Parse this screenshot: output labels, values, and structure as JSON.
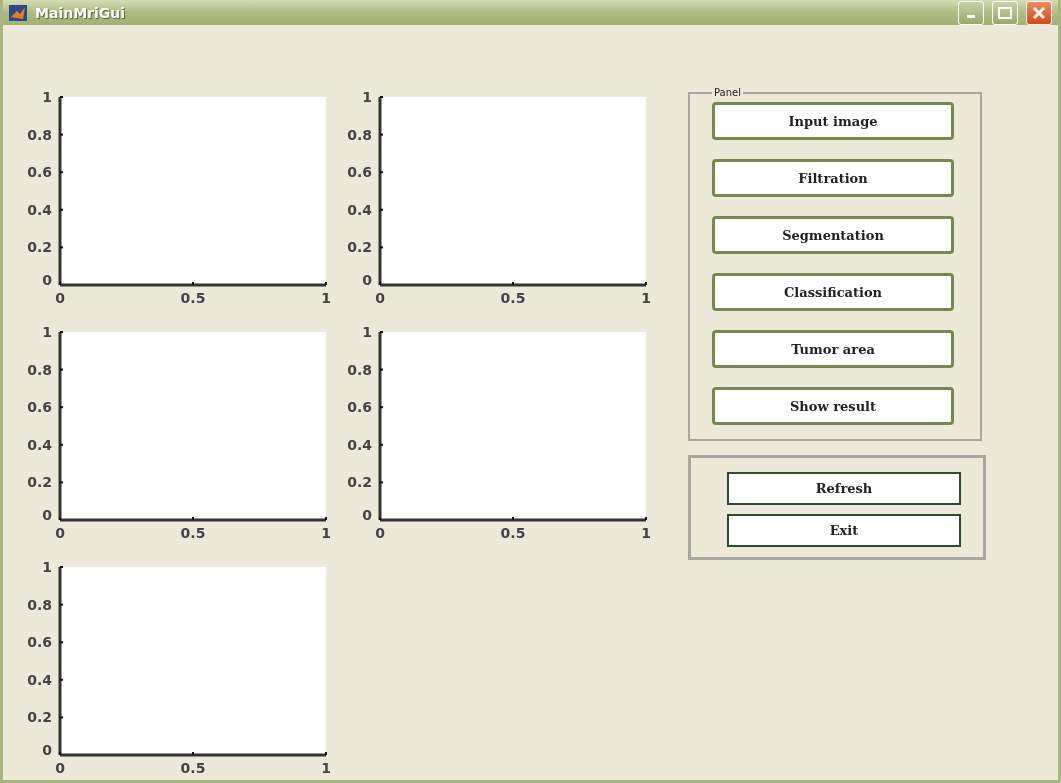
{
  "window": {
    "title": "MainMriGui"
  },
  "axes": [
    {
      "chart_data": {
        "type": "line",
        "xlim": [
          0,
          1
        ],
        "ylim": [
          0,
          1
        ],
        "xticks": [
          0,
          0.5,
          1
        ],
        "yticks": [
          0,
          0.2,
          0.4,
          0.6,
          0.8,
          1
        ]
      }
    },
    {
      "chart_data": {
        "type": "line",
        "xlim": [
          0,
          1
        ],
        "ylim": [
          0,
          1
        ],
        "xticks": [
          0,
          0.5,
          1
        ],
        "yticks": [
          0,
          0.2,
          0.4,
          0.6,
          0.8,
          1
        ]
      }
    },
    {
      "chart_data": {
        "type": "line",
        "xlim": [
          0,
          1
        ],
        "ylim": [
          0,
          1
        ],
        "xticks": [
          0,
          0.5,
          1
        ],
        "yticks": [
          0,
          0.2,
          0.4,
          0.6,
          0.8,
          1
        ]
      }
    },
    {
      "chart_data": {
        "type": "line",
        "xlim": [
          0,
          1
        ],
        "ylim": [
          0,
          1
        ],
        "xticks": [
          0,
          0.5,
          1
        ],
        "yticks": [
          0,
          0.2,
          0.4,
          0.6,
          0.8,
          1
        ]
      }
    },
    {
      "chart_data": {
        "type": "line",
        "xlim": [
          0,
          1
        ],
        "ylim": [
          0,
          1
        ],
        "xticks": [
          0,
          0.5,
          1
        ],
        "yticks": [
          0,
          0.2,
          0.4,
          0.6,
          0.8,
          1
        ]
      }
    }
  ],
  "panel": {
    "title": "Panel",
    "buttons": [
      "Input image",
      "Filtration",
      "Segmentation",
      "Classification",
      "Tumor area",
      "Show result"
    ]
  },
  "panel_2": {
    "buttons": [
      "Refresh",
      "Exit"
    ]
  }
}
